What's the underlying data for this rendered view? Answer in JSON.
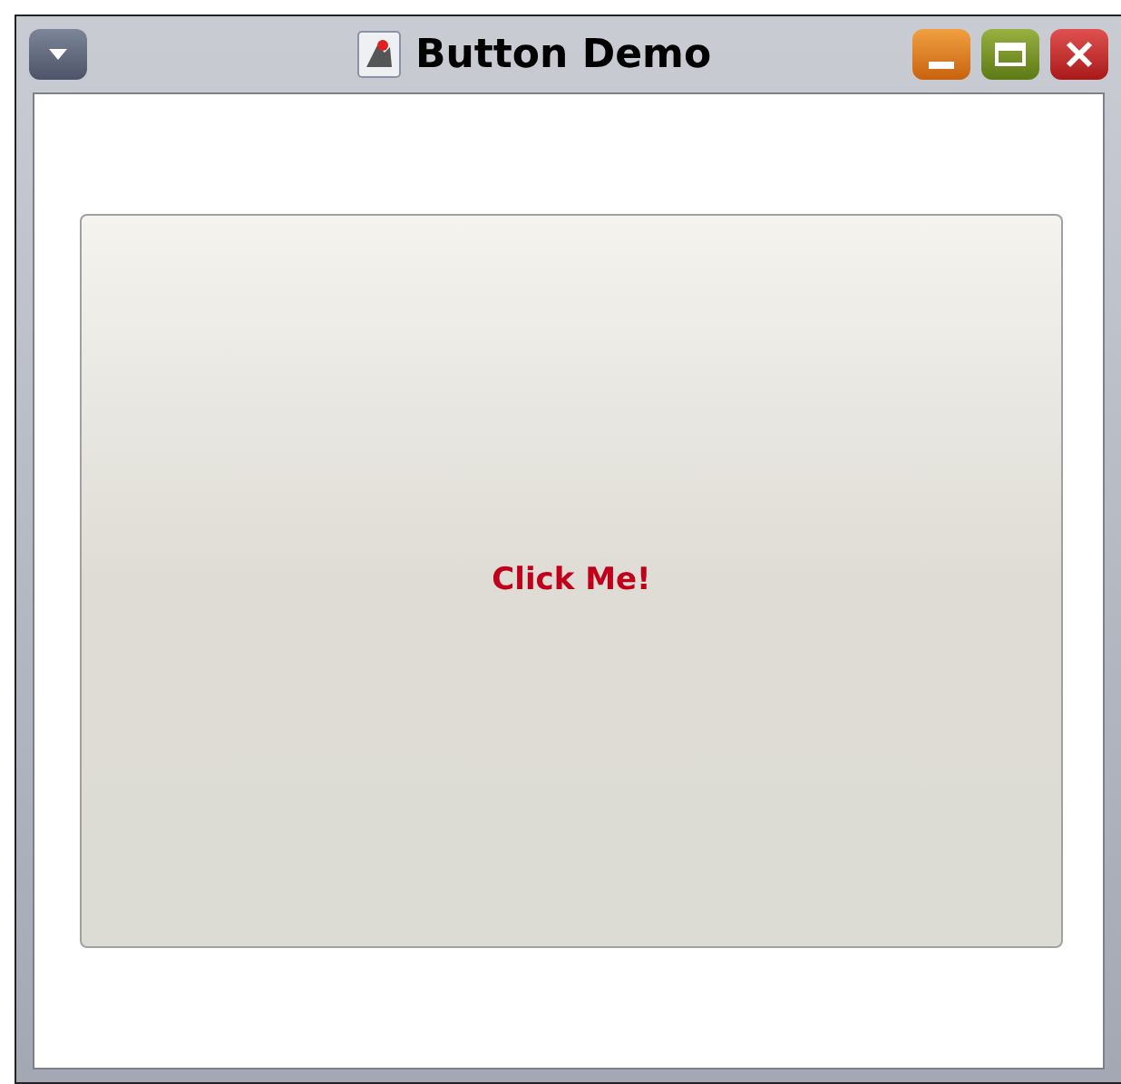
{
  "window": {
    "title": "Button Demo"
  },
  "button": {
    "label": "Click Me!"
  }
}
